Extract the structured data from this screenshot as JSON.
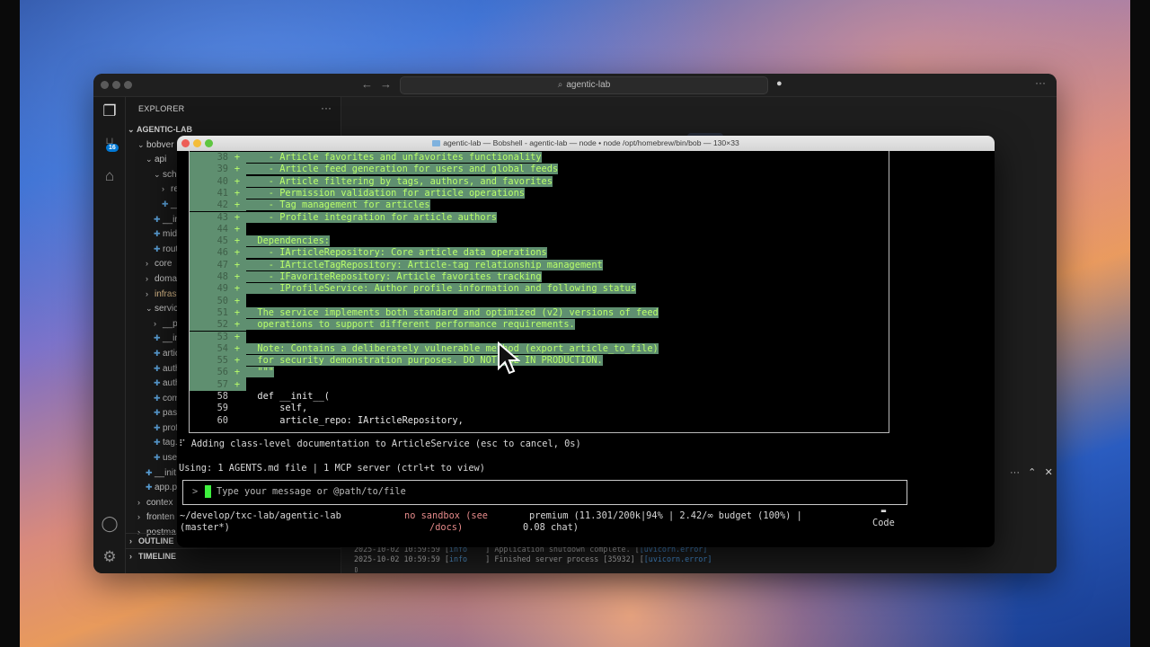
{
  "vscode": {
    "command_center": "agentic-lab",
    "explorer_title": "EXPLORER",
    "badge": "16",
    "root_folder": "AGENTIC-LAB",
    "tree": [
      {
        "label": "bobver",
        "indent": 1,
        "kind": "folder-open"
      },
      {
        "label": "api",
        "indent": 2,
        "kind": "folder-open"
      },
      {
        "label": "sche",
        "indent": 3,
        "kind": "folder-open"
      },
      {
        "label": "res",
        "indent": 4,
        "kind": "folder"
      },
      {
        "label": "__i",
        "indent": 4,
        "kind": "py"
      },
      {
        "label": "__in",
        "indent": 3,
        "kind": "py"
      },
      {
        "label": "mido",
        "indent": 3,
        "kind": "py"
      },
      {
        "label": "rout",
        "indent": 3,
        "kind": "py"
      },
      {
        "label": "core",
        "indent": 2,
        "kind": "folder"
      },
      {
        "label": "doma",
        "indent": 2,
        "kind": "folder"
      },
      {
        "label": "infras",
        "indent": 2,
        "kind": "folder"
      },
      {
        "label": "servic",
        "indent": 2,
        "kind": "folder-open"
      },
      {
        "label": "__py",
        "indent": 3,
        "kind": "folder"
      },
      {
        "label": "__in",
        "indent": 3,
        "kind": "py"
      },
      {
        "label": "artic",
        "indent": 3,
        "kind": "py"
      },
      {
        "label": "auth",
        "indent": 3,
        "kind": "py"
      },
      {
        "label": "auth",
        "indent": 3,
        "kind": "py"
      },
      {
        "label": "com",
        "indent": 3,
        "kind": "py"
      },
      {
        "label": "pass",
        "indent": 3,
        "kind": "py"
      },
      {
        "label": "prof",
        "indent": 3,
        "kind": "py"
      },
      {
        "label": "tag.p",
        "indent": 3,
        "kind": "py"
      },
      {
        "label": "user",
        "indent": 3,
        "kind": "py"
      },
      {
        "label": "__init",
        "indent": 2,
        "kind": "py"
      },
      {
        "label": "app.p",
        "indent": 2,
        "kind": "py"
      },
      {
        "label": "contex",
        "indent": 1,
        "kind": "folder"
      },
      {
        "label": "fronten",
        "indent": 1,
        "kind": "folder"
      },
      {
        "label": "postma",
        "indent": 1,
        "kind": "folder"
      }
    ],
    "outline": "OUTLINE",
    "timeline": "TIMELINE",
    "logs": [
      {
        "time": "2025-10-02 10:59:59",
        "level": "info",
        "msg": "Application shutdown complete.",
        "src": "[uvicorn.error]"
      },
      {
        "time": "2025-10-02 10:59:59",
        "level": "info",
        "msg": "Finished server process [35932]",
        "src": "[uvicorn.error]"
      }
    ]
  },
  "terminal": {
    "title": "agentic-lab — Bobshell - agentic-lab — node • node /opt/homebrew/bin/bob — 130×33",
    "diff_lines": [
      {
        "ln": "38",
        "plus": "+",
        "text": "    - Article favorites and unfavorites functionality",
        "hl": true
      },
      {
        "ln": "39",
        "plus": "+",
        "text": "    - Article feed generation for users and global feeds",
        "hl": true
      },
      {
        "ln": "40",
        "plus": "+",
        "text": "    - Article filtering by tags, authors, and favorites",
        "hl": true
      },
      {
        "ln": "41",
        "plus": "+",
        "text": "    - Permission validation for article operations",
        "hl": true
      },
      {
        "ln": "42",
        "plus": "+",
        "text": "    - Tag management for articles",
        "hl": true
      },
      {
        "ln": "43",
        "plus": "+",
        "text": "    - Profile integration for article authors",
        "hl": true
      },
      {
        "ln": "44",
        "plus": "+",
        "text": "",
        "hl": true
      },
      {
        "ln": "45",
        "plus": "+",
        "text": "  Dependencies:",
        "hl": true
      },
      {
        "ln": "46",
        "plus": "+",
        "text": "    - IArticleRepository: Core article data operations",
        "hl": true
      },
      {
        "ln": "47",
        "plus": "+",
        "text": "    - IArticleTagRepository: Article-tag relationship management",
        "hl": true
      },
      {
        "ln": "48",
        "plus": "+",
        "text": "    - IFavoriteRepository: Article favorites tracking",
        "hl": true
      },
      {
        "ln": "49",
        "plus": "+",
        "text": "    - IProfileService: Author profile information and following status",
        "hl": true
      },
      {
        "ln": "50",
        "plus": "+",
        "text": "",
        "hl": true
      },
      {
        "ln": "51",
        "plus": "+",
        "text": "  The service implements both standard and optimized (v2) versions of feed",
        "hl": true
      },
      {
        "ln": "52",
        "plus": "+",
        "text": "  operations to support different performance requirements.",
        "hl": true
      },
      {
        "ln": "53",
        "plus": "+",
        "text": "",
        "hl": true
      },
      {
        "ln": "54",
        "plus": "+",
        "text": "  Note: Contains a deliberately vulnerable method (export_article_to_file)",
        "hl": true
      },
      {
        "ln": "55",
        "plus": "+",
        "text": "  for security demonstration purposes. DO NOT USE IN PRODUCTION.",
        "hl": true
      },
      {
        "ln": "56",
        "plus": "+",
        "text": "  \"\"\"",
        "hl": true
      },
      {
        "ln": "57",
        "plus": "+",
        "text": "",
        "hl": true
      },
      {
        "ln": "58",
        "plus": "",
        "text": "  def __init__(",
        "hl": false
      },
      {
        "ln": "59",
        "plus": "",
        "text": "      self,",
        "hl": false
      },
      {
        "ln": "60",
        "plus": "",
        "text": "      article_repo: IArticleRepository,",
        "hl": false
      }
    ],
    "status": "Adding class-level documentation to ArticleService (esc to cancel, 0s)",
    "context": "Using: 1 AGENTS.md file | 1 MCP server (ctrl+t to view)",
    "input_prompt": ">",
    "input_placeholder": "Type your message or @path/to/file",
    "footer": {
      "path": "~/develop/txc-lab/agentic-lab",
      "branch": "(master*)",
      "sandbox": "no sandbox (see",
      "sandbox2": "/docs)",
      "model": "premium (11.301/200k|94% | 2.42/∞ budget (100%) |",
      "model2": "0.08 chat)",
      "mode": "Code"
    }
  },
  "colors": {
    "highlight_bg": "#5f8f70",
    "highlight_text": "#b9ff6a",
    "cursor": "#3ef03e",
    "badge": "#0078d4"
  }
}
